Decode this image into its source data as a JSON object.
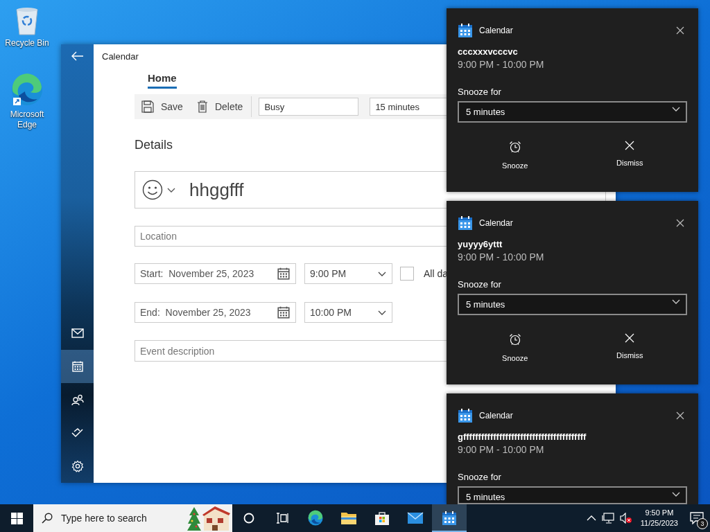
{
  "desktop_icons": [
    {
      "kind": "recycle-bin",
      "label": "Recycle Bin"
    },
    {
      "kind": "edge",
      "label": "Microsoft Edge"
    }
  ],
  "calendar_window": {
    "title": "Calendar",
    "nav": [
      {
        "kind": "mail",
        "selected": false
      },
      {
        "kind": "calendar",
        "selected": true
      },
      {
        "kind": "people",
        "selected": false
      },
      {
        "kind": "todo",
        "selected": false
      },
      {
        "kind": "settings",
        "selected": false
      }
    ],
    "tabs": [
      {
        "label": "Home",
        "selected": true
      }
    ],
    "toolbar": {
      "buttons": [
        {
          "kind": "save",
          "label": "Save"
        },
        {
          "kind": "delete",
          "label": "Delete"
        }
      ],
      "show_as": "Busy",
      "reminder": "15 minutes"
    },
    "section_title": "Details",
    "event_title": "hhggfff",
    "location": {
      "placeholder": "Location"
    },
    "start": {
      "label": "Start:",
      "date": "November 25, 2023",
      "time": "9:00 PM"
    },
    "all_day": {
      "label": "All da",
      "checked": false
    },
    "end": {
      "label": "End:",
      "date": "November 25, 2023",
      "time": "10:00 PM"
    },
    "description": {
      "placeholder": "Event description"
    }
  },
  "notifications": [
    {
      "app": "Calendar",
      "title": "cccxxxvcccvc",
      "time": "9:00 PM - 10:00 PM",
      "snooze_label": "Snooze for",
      "snooze_value": "5 minutes",
      "actions": [
        {
          "kind": "snooze",
          "label": "Snooze"
        },
        {
          "kind": "dismiss",
          "label": "Dismiss"
        }
      ]
    },
    {
      "app": "Calendar",
      "title": "yuyyy6yttt",
      "time": "9:00 PM - 10:00 PM",
      "snooze_label": "Snooze for",
      "snooze_value": "5 minutes",
      "actions": [
        {
          "kind": "snooze",
          "label": "Snooze"
        },
        {
          "kind": "dismiss",
          "label": "Dismiss"
        }
      ]
    },
    {
      "app": "Calendar",
      "title": "gfffffffffffffffffffffffffffffffffffffffff",
      "time": "9:00 PM - 10:00 PM",
      "snooze_label": "Snooze for",
      "snooze_value": "5 minutes"
    }
  ],
  "taskbar": {
    "search": {
      "placeholder": "Type here to search"
    },
    "apps": [
      {
        "kind": "cortana",
        "selected": false
      },
      {
        "kind": "task-view",
        "selected": false
      },
      {
        "kind": "edge",
        "selected": false
      },
      {
        "kind": "explorer",
        "selected": false
      },
      {
        "kind": "store",
        "selected": false
      },
      {
        "kind": "mail",
        "selected": false
      },
      {
        "kind": "calendar",
        "selected": true
      }
    ],
    "clock": {
      "time": "9:50 PM",
      "date": "11/25/2023"
    },
    "notification_count": "3"
  }
}
